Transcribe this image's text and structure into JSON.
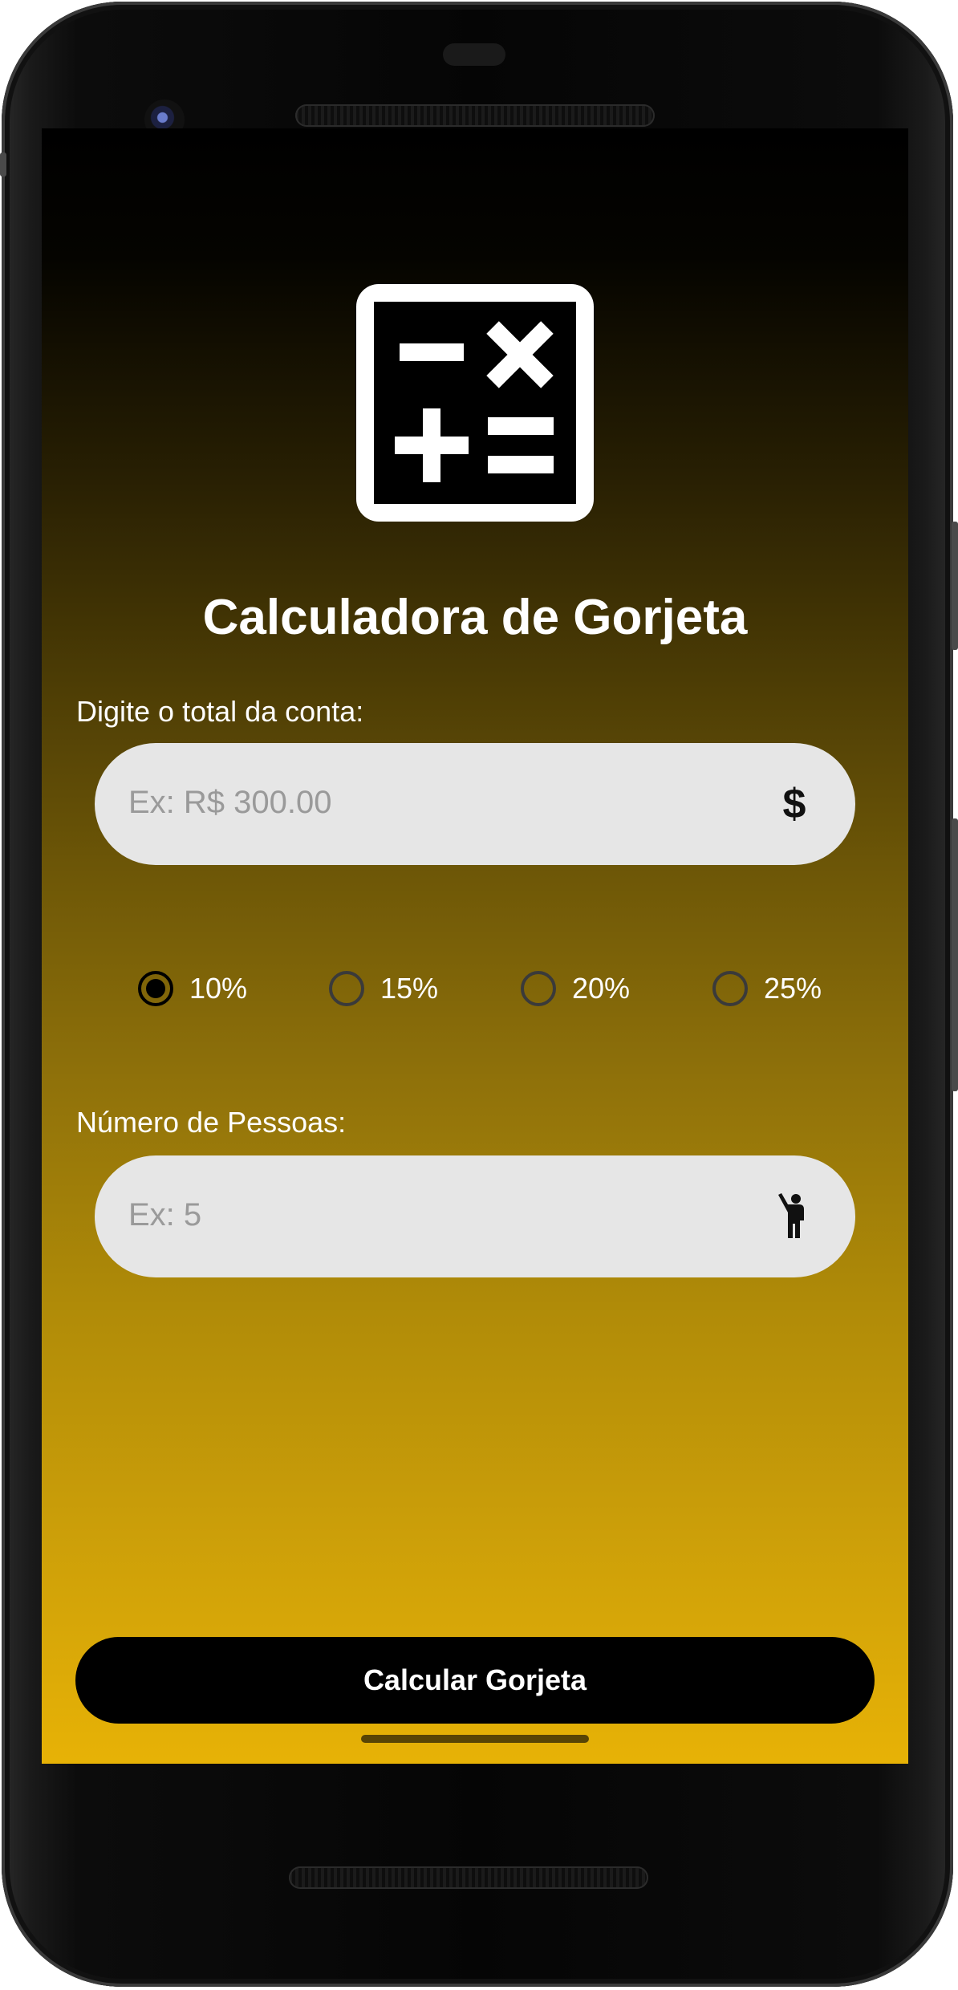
{
  "app": {
    "title": "Calculadora de Gorjeta",
    "icon": "calculator-icon"
  },
  "bill": {
    "label": "Digite o total da conta:",
    "placeholder": "Ex: R$ 300.00",
    "icon": "dollar-icon",
    "icon_glyph": "$"
  },
  "tip_options": [
    {
      "label": "10%",
      "selected": true
    },
    {
      "label": "15%",
      "selected": false
    },
    {
      "label": "20%",
      "selected": false
    },
    {
      "label": "25%",
      "selected": false
    }
  ],
  "people": {
    "label": "Número de Pessoas:",
    "placeholder": "Ex: 5",
    "icon": "person-icon"
  },
  "action": {
    "button_label": "Calcular Gorjeta"
  },
  "colors": {
    "gradient_top": "#000000",
    "gradient_bottom": "#e7b206",
    "field_bg": "#e6e6e6",
    "button_bg": "#000000",
    "text": "#ffffff"
  }
}
